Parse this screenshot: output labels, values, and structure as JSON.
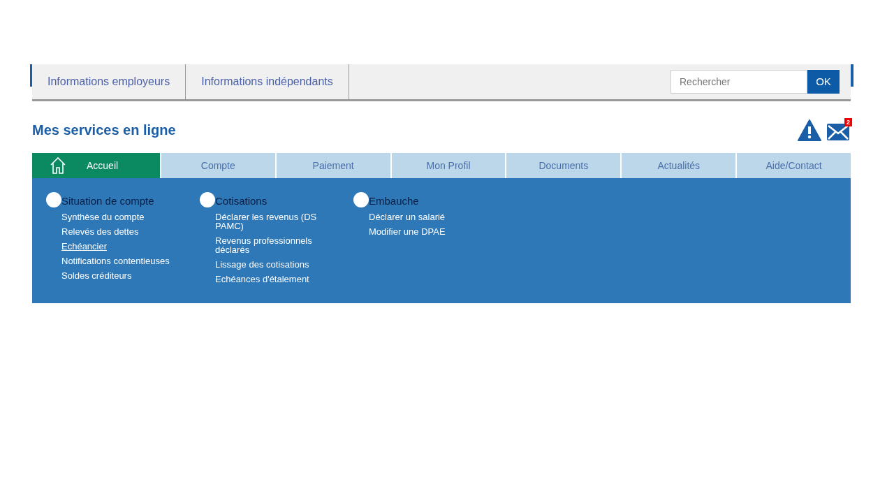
{
  "top_links": [
    {
      "label": "Informations employeurs"
    },
    {
      "label": "Informations indépendants"
    }
  ],
  "search": {
    "placeholder": "Rechercher",
    "button": "OK"
  },
  "page_title": "Mes services en ligne",
  "messages": {
    "count": "2"
  },
  "tabs": [
    {
      "label": "Accueil",
      "selected": true,
      "kind": "home"
    },
    {
      "label": "Compte",
      "selected": false,
      "kind": "plain"
    },
    {
      "label": "Paiement",
      "selected": false,
      "kind": "plain"
    },
    {
      "label": "Mon Profil",
      "selected": false,
      "kind": "plain"
    },
    {
      "label": "Documents",
      "selected": false,
      "kind": "plain"
    },
    {
      "label": "Actualités",
      "selected": false,
      "kind": "plain"
    },
    {
      "label": "Aide/Contact",
      "selected": false,
      "kind": "plain"
    }
  ],
  "menu_columns": [
    {
      "heading": "Situation de compte",
      "items": [
        {
          "label": "Synthèse du compte",
          "selected": false
        },
        {
          "label": "Relevés des dettes",
          "selected": false
        },
        {
          "label": "Echéancier",
          "selected": true
        },
        {
          "label": "Notifications contentieuses",
          "selected": false
        },
        {
          "label": "Soldes créditeurs",
          "selected": false
        }
      ]
    },
    {
      "heading": "Cotisations",
      "items": [
        {
          "label": "Déclarer les revenus (DS PAMC)",
          "selected": false
        },
        {
          "label": "Revenus professionnels déclarés",
          "selected": false
        },
        {
          "label": "Lissage des cotisations",
          "selected": false
        },
        {
          "label": "Echéances d'étalement",
          "selected": false
        }
      ]
    },
    {
      "heading": "Embauche",
      "items": [
        {
          "label": "Déclarer un salarié",
          "selected": false
        },
        {
          "label": "Modifier une DPAE",
          "selected": false
        }
      ]
    }
  ]
}
